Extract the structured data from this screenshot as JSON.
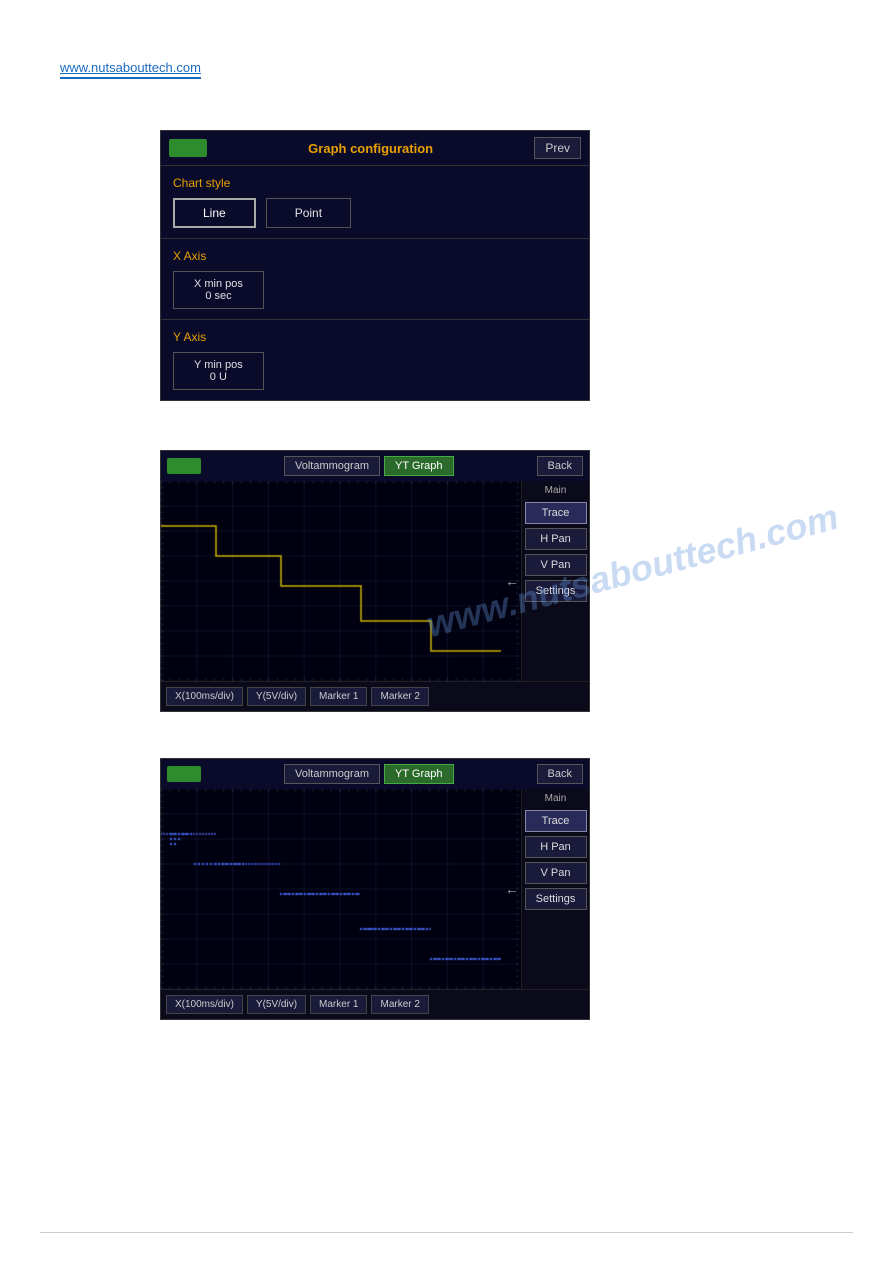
{
  "topLink": {
    "text": "www.nutsabouttech.com"
  },
  "panel1": {
    "title": "Graph configuration",
    "prevButton": "Prev",
    "greenRect": "green-indicator",
    "chartStyleLabel": "Chart style",
    "lineButton": "Line",
    "pointButton": "Point",
    "xAxisLabel": "X Axis",
    "xMinPosLine1": "X min pos",
    "xMinPosLine2": "0 sec",
    "yAxisLabel": "Y Axis",
    "yMinPosLine1": "Y min pos",
    "yMinPosLine2": "0 U"
  },
  "panel2": {
    "tab1": "Voltammogram",
    "tab2": "YT Graph",
    "backButton": "Back",
    "mainLabel": "Main",
    "traceButton": "Trace",
    "hPanButton": "H Pan",
    "vPanButton": "V Pan",
    "settingsButton": "Settings",
    "footer": {
      "xScale": "X(100ms/div)",
      "yScale": "Y(5V/div)",
      "marker1": "Marker 1",
      "marker2": "Marker 2"
    },
    "trace": {
      "type": "line",
      "color": "#c8b400"
    }
  },
  "panel3": {
    "tab1": "Voltammogram",
    "tab2": "YT Graph",
    "backButton": "Back",
    "mainLabel": "Main",
    "traceButton": "Trace",
    "hPanButton": "H Pan",
    "vPanButton": "V Pan",
    "settingsButton": "Settings",
    "footer": {
      "xScale": "X(100ms/div)",
      "yScale": "Y(5V/div)",
      "marker1": "Marker 1",
      "marker2": "Marker 2"
    },
    "trace": {
      "type": "dot",
      "color": "#3060ff"
    }
  },
  "watermark": "www.nutsabouttech.com"
}
